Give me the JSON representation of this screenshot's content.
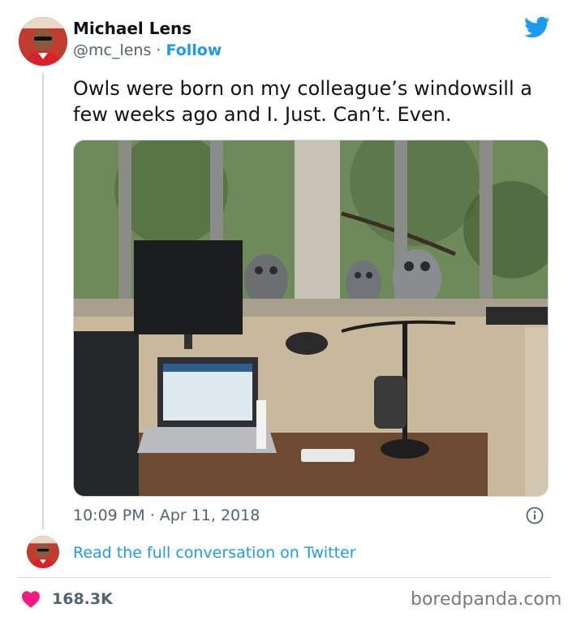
{
  "author": {
    "name": "Michael Lens",
    "handle": "@mc_lens",
    "separator": "·",
    "follow_label": "Follow"
  },
  "tweet": {
    "text": "Owls were born on my colleague’s windowsill a few weeks ago and I. Just. Can’t. Even.",
    "time": "10:09 PM",
    "date_separator": "·",
    "date": "Apr 11, 2018"
  },
  "conversation": {
    "link_label": "Read the full conversation on Twitter"
  },
  "stats": {
    "likes": "168.3K"
  },
  "watermark": "boredpanda.com",
  "icons": {
    "brand": "twitter-bird-icon",
    "info": "info-icon",
    "like": "heart-icon"
  },
  "colors": {
    "accent": "#1d9bf0",
    "text": "#0f1419",
    "secondary_text": "#536471",
    "heart": "#f91880",
    "divider": "#cfd9de"
  }
}
